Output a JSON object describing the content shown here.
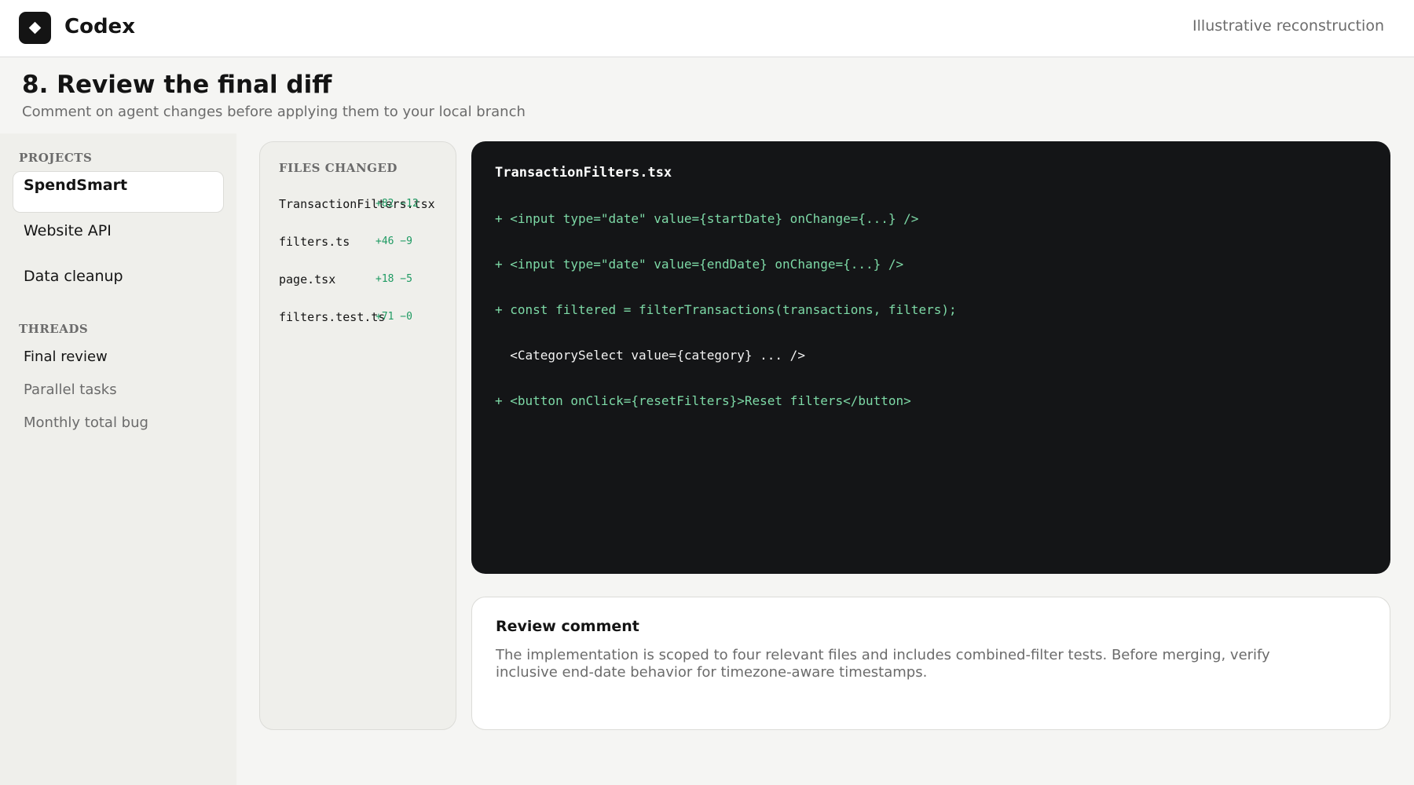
{
  "app": {
    "name": "Codex",
    "logo_icon": "diamond-icon",
    "note": "Illustrative reconstruction"
  },
  "page": {
    "title": "8. Review the final diff",
    "subtitle": "Comment on agent changes before applying them to your local branch"
  },
  "sidebar": {
    "projects_label": "PROJECTS",
    "projects": [
      {
        "label": "SpendSmart",
        "active": true
      },
      {
        "label": "Website API",
        "active": false
      },
      {
        "label": "Data cleanup",
        "active": false
      }
    ],
    "threads_label": "THREADS",
    "threads": [
      {
        "label": "Final review",
        "active": true
      },
      {
        "label": "Parallel tasks",
        "active": false
      },
      {
        "label": "Monthly total bug",
        "active": false
      }
    ]
  },
  "files": {
    "heading": "FILES CHANGED",
    "items": [
      {
        "name": "TransactionFilters.tsx",
        "stats": "+82 −12"
      },
      {
        "name": "filters.ts",
        "stats": "+46 −9"
      },
      {
        "name": "page.tsx",
        "stats": "+18 −5"
      },
      {
        "name": "filters.test.ts",
        "stats": "+71 −0"
      }
    ]
  },
  "diff": {
    "filename": "TransactionFilters.tsx",
    "lines": [
      {
        "text": "+ <input type=\"date\" value={startDate} onChange={...} />",
        "kind": "added"
      },
      {
        "text": "+ <input type=\"date\" value={endDate} onChange={...} />",
        "kind": "added"
      },
      {
        "text": "+ const filtered = filterTransactions(transactions, filters);",
        "kind": "added"
      },
      {
        "text": "  <CategorySelect value={category} ... />",
        "kind": "context"
      },
      {
        "text": "+ <button onClick={resetFilters}>Reset filters</button>",
        "kind": "added"
      }
    ]
  },
  "review": {
    "title": "Review comment",
    "body": "The implementation is scoped to four relevant files and includes combined-filter tests. Before merging, verify inclusive end-date behavior for timezone-aware timestamps."
  },
  "colors": {
    "accent_added": "#7dd9a6",
    "stats_green": "#1e9a62",
    "code_bg": "#141517"
  }
}
